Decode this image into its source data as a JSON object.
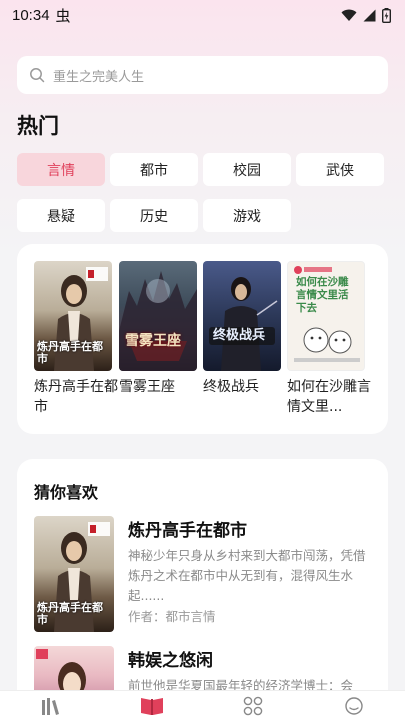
{
  "status_bar": {
    "time": "10:34",
    "notification_glyph": "虫"
  },
  "search": {
    "placeholder": "重生之完美人生"
  },
  "section_title": "热门",
  "tags": [
    {
      "label": "言情",
      "active": true
    },
    {
      "label": "都市",
      "active": false
    },
    {
      "label": "校园",
      "active": false
    },
    {
      "label": "武侠",
      "active": false
    },
    {
      "label": "悬疑",
      "active": false
    },
    {
      "label": "历史",
      "active": false
    },
    {
      "label": "游戏",
      "active": false
    }
  ],
  "hot_books": [
    {
      "title": "炼丹高手在都市",
      "cover_text": "炼丹高手在都市"
    },
    {
      "title": "雪雾王座",
      "cover_text": "雪雾王座"
    },
    {
      "title": "终极战兵",
      "cover_text": "终极战兵"
    },
    {
      "title": "如何在沙雕言情文里...",
      "cover_text": "如何在沙雕言情文里活下去"
    }
  ],
  "guess": {
    "title": "猜你喜欢",
    "items": [
      {
        "title": "炼丹高手在都市",
        "desc": "神秘少年只身从乡村来到大都市闯荡，凭借炼丹之术在都市中从无到有，混得风生水起......",
        "author": "作者：都市言情"
      },
      {
        "title": "韩娱之悠闲",
        "desc": "前世他是华夏国最年轻的经济学博士：会",
        "author": ""
      }
    ]
  },
  "nav": [
    {
      "icon": "bookshelf-icon"
    },
    {
      "icon": "book-open-icon"
    },
    {
      "icon": "category-grid-icon"
    },
    {
      "icon": "profile-smile-icon"
    }
  ],
  "colors": {
    "accent": "#e0405b",
    "tag_active_bg": "#f8d6dc",
    "card_bg": "#ffffff"
  }
}
